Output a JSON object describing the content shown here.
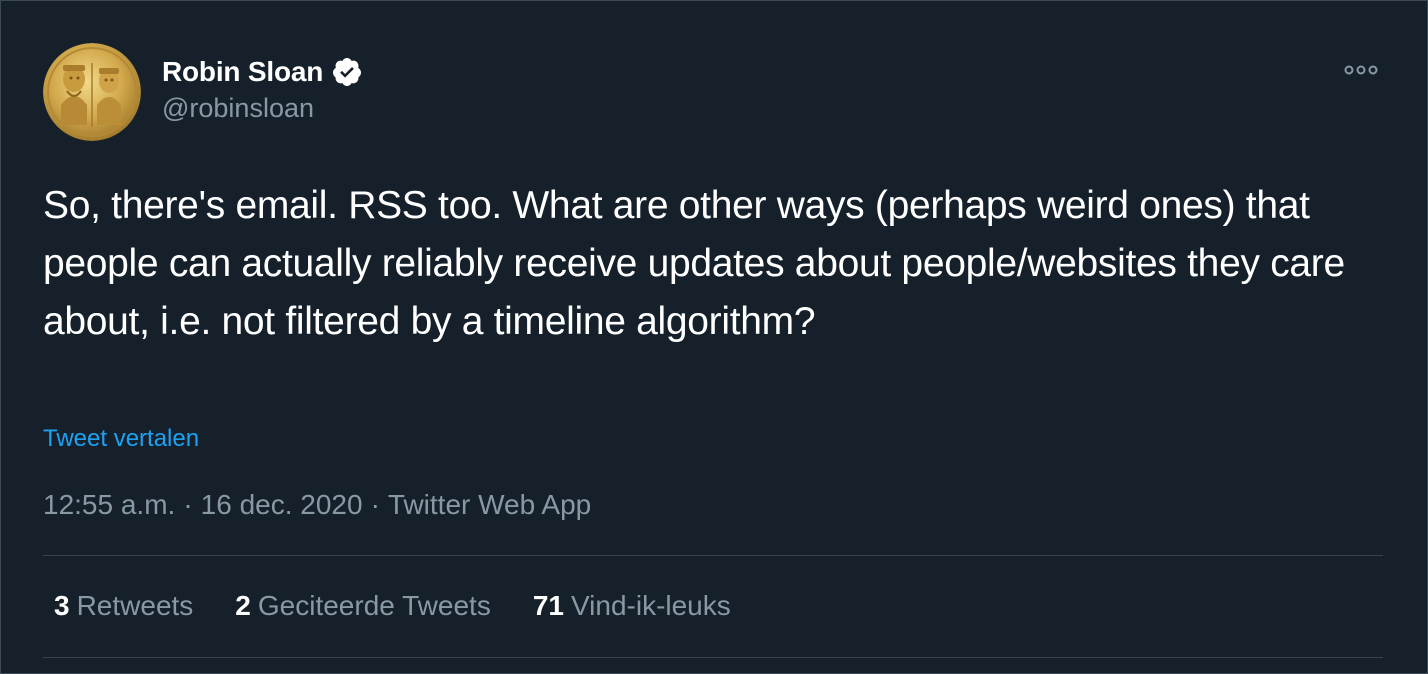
{
  "author": {
    "name": "Robin Sloan",
    "handle": "@robinsloan",
    "verified": true,
    "avatar_icon": "gold-coin-portrait-avatar"
  },
  "tweet": {
    "text": "So, there's email. RSS too. What are other ways (perhaps weird ones) that people can actually reliably receive updates about people/websites they care about, i.e. not filtered by a timeline algorithm?",
    "translate_label": "Tweet vertalen"
  },
  "meta": {
    "time": "12:55 a.m.",
    "separator": "·",
    "date": "16 dec. 2020",
    "source": "Twitter Web App"
  },
  "stats": {
    "retweets": {
      "count": "3",
      "label": "Retweets"
    },
    "quotes": {
      "count": "2",
      "label": "Geciteerde Tweets"
    },
    "likes": {
      "count": "71",
      "label": "Vind-ik-leuks"
    }
  },
  "icons": {
    "more": "more-options-icon",
    "verified": "verified-badge-icon"
  },
  "colors": {
    "background": "#15202b",
    "text": "#ffffff",
    "secondary_text": "#8899a6",
    "link": "#1da1f2",
    "divider": "#38444d"
  }
}
